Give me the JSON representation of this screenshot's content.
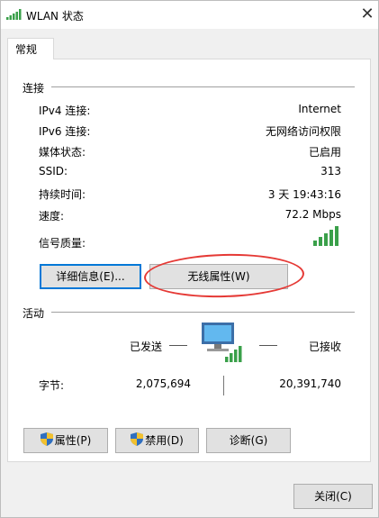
{
  "window": {
    "title": "WLAN 状态",
    "close_glyph": "✕"
  },
  "tabs": [
    {
      "label": "常规"
    }
  ],
  "connection": {
    "heading": "连接",
    "rows": [
      {
        "label": "IPv4 连接:",
        "value": "Internet"
      },
      {
        "label": "IPv6 连接:",
        "value": "无网络访问权限"
      },
      {
        "label": "媒体状态:",
        "value": "已启用"
      },
      {
        "label": "SSID:",
        "value": "313"
      },
      {
        "label": "持续时间:",
        "value": "3 天 19:43:16"
      },
      {
        "label": "速度:",
        "value": "72.2 Mbps"
      }
    ],
    "signal_label": "信号质量:",
    "signal_bars": 5,
    "details_button": "详细信息(E)...",
    "wireless_button": "无线属性(W)"
  },
  "activity": {
    "heading": "活动",
    "sent_label": "已发送",
    "received_label": "已接收",
    "bytes_label": "字节:",
    "bytes_sent": "2,075,694",
    "bytes_received": "20,391,740"
  },
  "buttons": {
    "properties": "属性(P)",
    "disable": "禁用(D)",
    "diagnose": "诊断(G)",
    "close": "关闭(C)"
  },
  "colors": {
    "accent": "#0078d7",
    "signal_green": "#3aa04a",
    "annotation_red": "#e53935"
  }
}
